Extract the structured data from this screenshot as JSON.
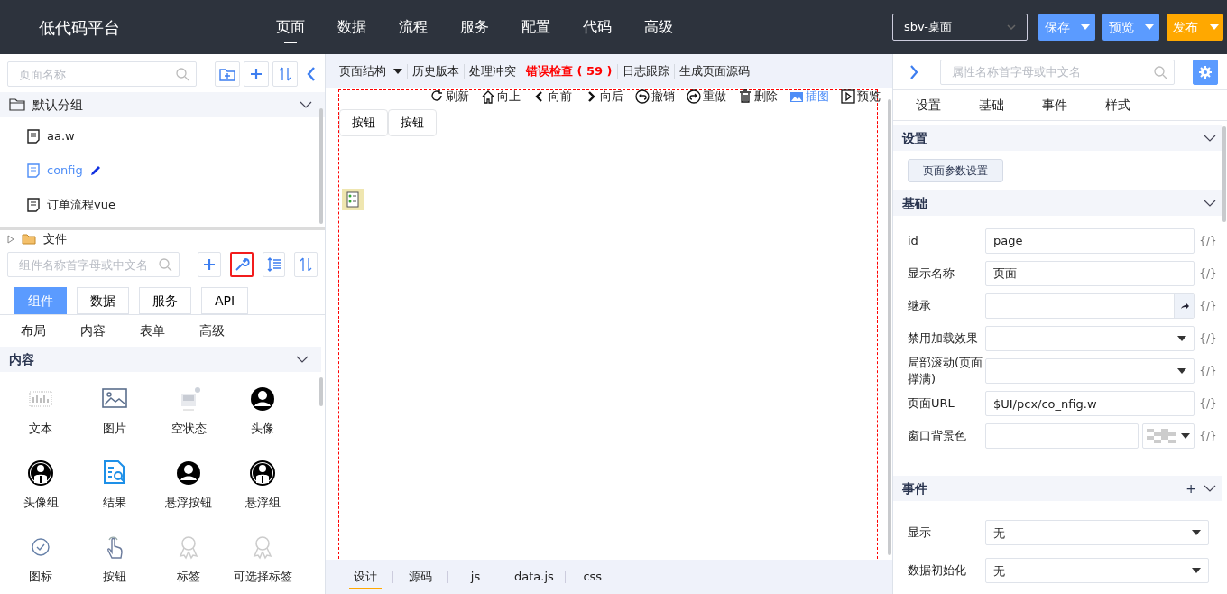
{
  "header": {
    "title": "低代码平台",
    "nav": [
      {
        "label": "页面",
        "selected": true
      },
      {
        "label": "数据",
        "selected": false
      },
      {
        "label": "流程",
        "selected": false
      },
      {
        "label": "服务",
        "selected": false
      },
      {
        "label": "配置",
        "selected": false
      },
      {
        "label": "代码",
        "selected": false
      },
      {
        "label": "高级",
        "selected": false
      }
    ],
    "device_select": "sbv-桌面",
    "actions": [
      {
        "label": "保存",
        "kind": "primary"
      },
      {
        "label": "预览",
        "kind": "primary"
      },
      {
        "label": "发布",
        "kind": "warning"
      }
    ]
  },
  "left_panel": {
    "page_search": {
      "placeholder": "页面名称"
    },
    "group": {
      "label": "默认分组",
      "expanded": true,
      "pages": [
        {
          "label": "aa.w",
          "selected": false
        },
        {
          "label": "config",
          "selected": true
        },
        {
          "label": "订单流程vue",
          "selected": false
        }
      ]
    },
    "folder": {
      "label": "文件",
      "expanded": false
    },
    "component_search": {
      "placeholder": "组件名称首字母或中文名"
    },
    "component_tools": [
      {
        "kind": "add",
        "highlighted": false
      },
      {
        "kind": "wrench",
        "highlighted": true
      },
      {
        "kind": "indent",
        "highlighted": false
      },
      {
        "kind": "sort",
        "highlighted": false
      }
    ],
    "tabs": [
      {
        "label": "组件",
        "selected": true
      },
      {
        "label": "数据",
        "selected": false
      },
      {
        "label": "服务",
        "selected": false
      },
      {
        "label": "API",
        "selected": false
      }
    ],
    "categories": [
      "布局",
      "内容",
      "表单",
      "高级"
    ],
    "section": {
      "title": "内容",
      "expanded": true
    },
    "components": [
      {
        "label": "文本",
        "kind": "text"
      },
      {
        "label": "图片",
        "kind": "image"
      },
      {
        "label": "空状态",
        "kind": "empty"
      },
      {
        "label": "头像",
        "kind": "avatar"
      },
      {
        "label": "头像组",
        "kind": "avatar-group"
      },
      {
        "label": "结果",
        "kind": "result"
      },
      {
        "label": "悬浮按钮",
        "kind": "avatar"
      },
      {
        "label": "悬浮组",
        "kind": "avatar-group"
      },
      {
        "label": "图标",
        "kind": "check"
      },
      {
        "label": "按钮",
        "kind": "hand"
      },
      {
        "label": "标签",
        "kind": "ribbon"
      },
      {
        "label": "可选择标签",
        "kind": "ribbon"
      }
    ]
  },
  "canvas": {
    "toolbar": [
      {
        "label": "页面结构",
        "kind": "dropdown"
      },
      {
        "label": "历史版本",
        "kind": "plain"
      },
      {
        "label": "处理冲突",
        "kind": "plain"
      },
      {
        "label": "错误检查 ( 59 )",
        "kind": "error"
      },
      {
        "label": "日志跟踪",
        "kind": "plain"
      },
      {
        "label": "生成页面源码",
        "kind": "plain"
      }
    ],
    "actions": [
      {
        "label": "刷新",
        "kind": "refresh",
        "selected": false
      },
      {
        "label": "向上",
        "kind": "home",
        "selected": false
      },
      {
        "label": "向前",
        "kind": "left",
        "selected": false
      },
      {
        "label": "向后",
        "kind": "right",
        "selected": false
      },
      {
        "label": "撤销",
        "kind": "undo",
        "selected": false
      },
      {
        "label": "重做",
        "kind": "redo",
        "selected": false
      },
      {
        "label": "删除",
        "kind": "trash",
        "selected": false
      },
      {
        "label": "插图",
        "kind": "image",
        "selected": true
      },
      {
        "label": "预览",
        "kind": "play",
        "selected": false
      }
    ],
    "buttons": [
      "按钮",
      "按钮"
    ],
    "bottom_tabs": [
      {
        "label": "设计",
        "selected": true
      },
      {
        "label": "源码",
        "selected": false
      },
      {
        "label": "js",
        "selected": false
      },
      {
        "label": "data.js",
        "selected": false
      },
      {
        "label": "css",
        "selected": false
      }
    ]
  },
  "right_panel": {
    "search": {
      "placeholder": "属性名称首字母或中文名"
    },
    "tabs": [
      "设置",
      "基础",
      "事件",
      "样式"
    ],
    "sections": [
      {
        "title": "设置",
        "expanded": true,
        "addable": false,
        "button": "页面参数设置"
      },
      {
        "title": "基础",
        "expanded": true,
        "addable": false,
        "fields": [
          {
            "label": "id",
            "kind": "text",
            "value": "page",
            "binding": "{/}"
          },
          {
            "label": "显示名称",
            "kind": "text",
            "value": "页面",
            "binding": "{/}"
          },
          {
            "label": "继承",
            "kind": "picker",
            "binding": "{/}"
          },
          {
            "label": "禁用加载效果",
            "kind": "select",
            "binding": "{/}"
          },
          {
            "label": "局部滚动(页面撑满)",
            "kind": "select",
            "binding": "{/}"
          },
          {
            "label": "页面URL",
            "kind": "text",
            "value": "$UI/pcx/co_nfig.w",
            "binding": "{/}"
          },
          {
            "label": "窗口背景色",
            "kind": "color",
            "binding": "{/}"
          }
        ]
      },
      {
        "title": "事件",
        "expanded": true,
        "addable": true,
        "add_label": "+",
        "fields": [
          {
            "label": "显示",
            "kind": "select",
            "value": "无"
          },
          {
            "label": "数据初始化",
            "kind": "select",
            "value": "无"
          }
        ]
      }
    ]
  }
}
